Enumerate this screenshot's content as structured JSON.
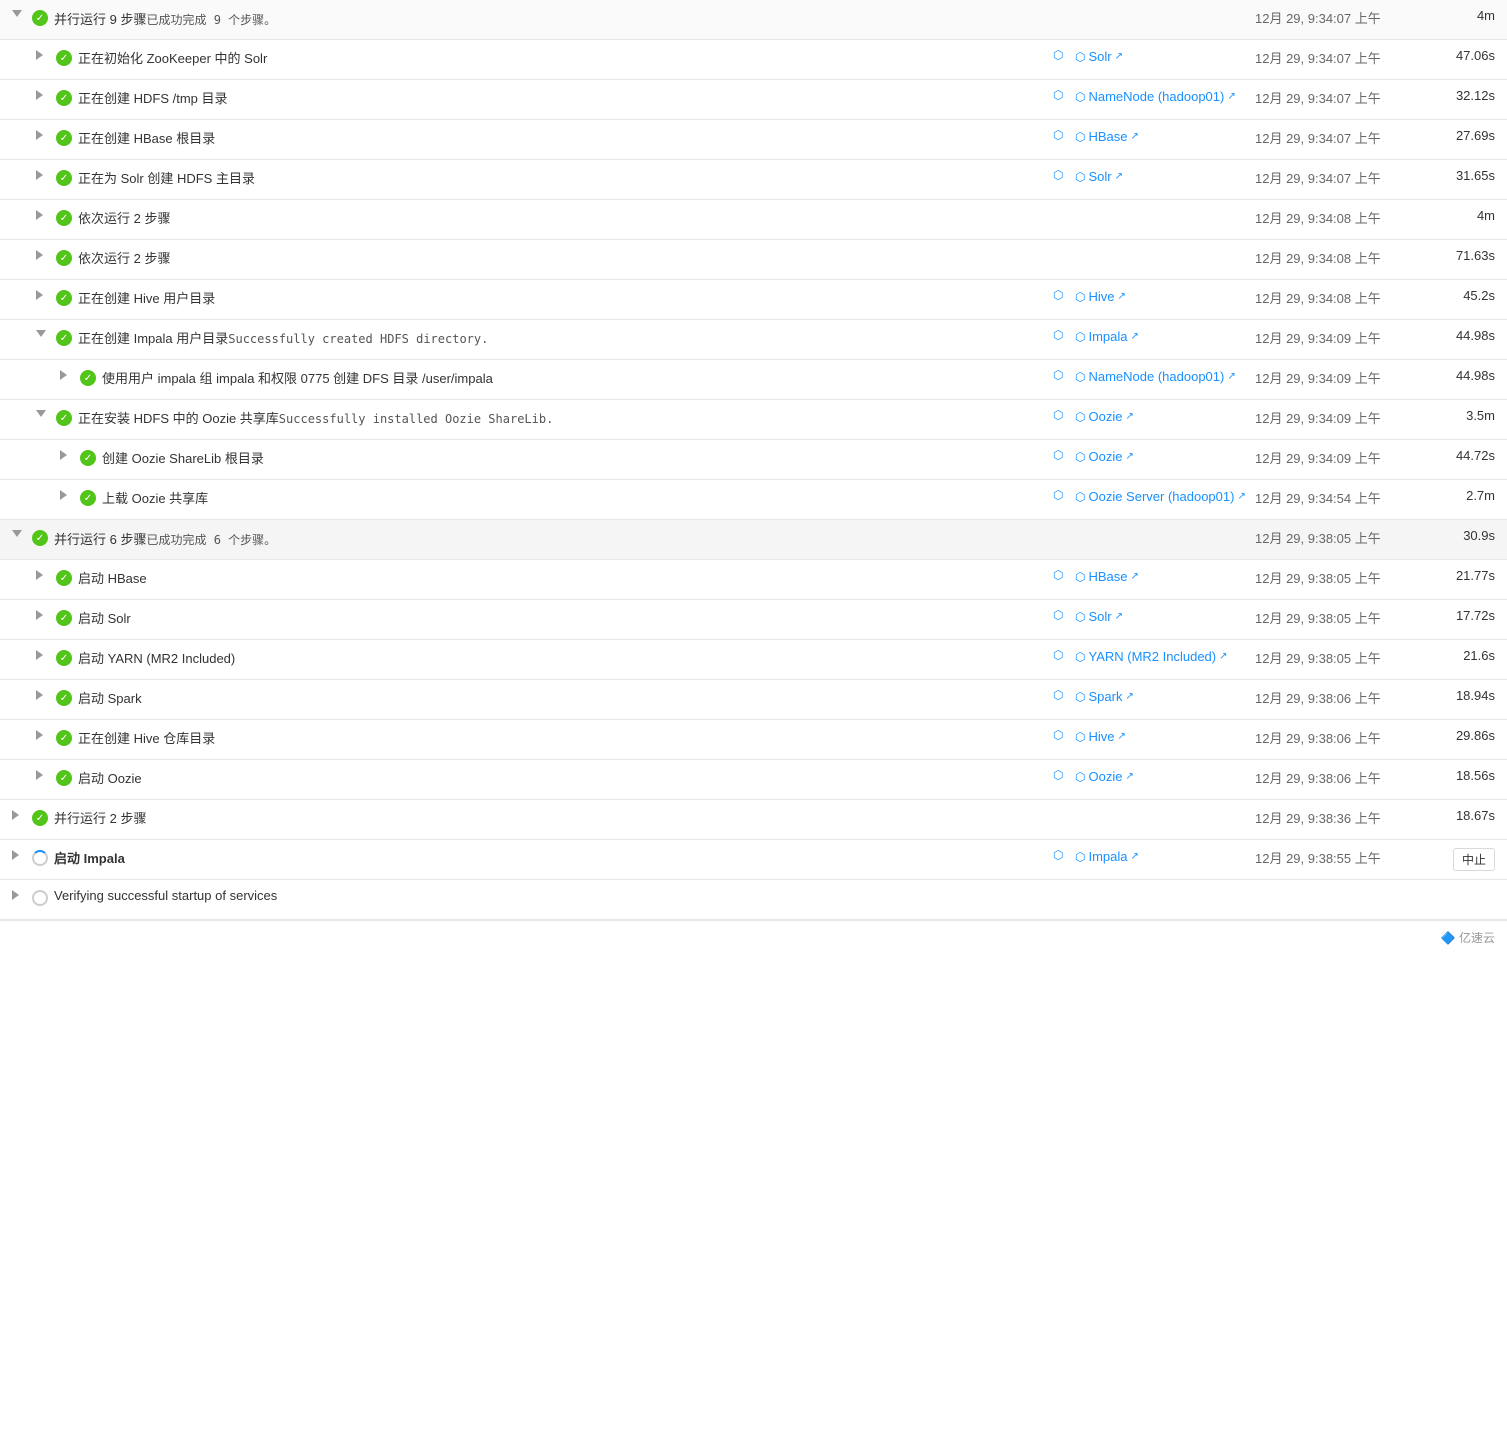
{
  "rows": [
    {
      "id": "parallel-9",
      "type": "parallel-header",
      "indent": 0,
      "expand": "down",
      "status": "success",
      "desc": "并行运行 9 步骤",
      "subdesc": "已成功完成  9  个步骤。",
      "service": "",
      "time": "12月 29, 9:34:07 上午",
      "duration": "4m",
      "action": ""
    },
    {
      "id": "step-solr-init",
      "type": "step",
      "indent": 1,
      "expand": "right",
      "status": "success",
      "desc": "正在初始化 ZooKeeper 中的 Solr",
      "subdesc": "",
      "service": "Solr",
      "time": "12月 29, 9:34:07 上午",
      "duration": "47.06s",
      "action": ""
    },
    {
      "id": "step-hdfs-tmp",
      "type": "step",
      "indent": 1,
      "expand": "right",
      "status": "success",
      "desc": "正在创建 HDFS /tmp 目录",
      "subdesc": "",
      "service": "NameNode (hadoop01)",
      "time": "12月 29, 9:34:07 上午",
      "duration": "32.12s",
      "action": ""
    },
    {
      "id": "step-hbase-root",
      "type": "step",
      "indent": 1,
      "expand": "right",
      "status": "success",
      "desc": "正在创建 HBase 根目录",
      "subdesc": "",
      "service": "HBase",
      "time": "12月 29, 9:34:07 上午",
      "duration": "27.69s",
      "action": ""
    },
    {
      "id": "step-solr-hdfs",
      "type": "step",
      "indent": 1,
      "expand": "right",
      "status": "success",
      "desc": "正在为 Solr 创建 HDFS 主目录",
      "subdesc": "",
      "service": "Solr",
      "time": "12月 29, 9:34:07 上午",
      "duration": "31.65s",
      "action": ""
    },
    {
      "id": "seq-2a",
      "type": "step",
      "indent": 1,
      "expand": "right",
      "status": "success",
      "desc": "依次运行 2 步骤",
      "subdesc": "",
      "service": "",
      "time": "12月 29, 9:34:08 上午",
      "duration": "4m",
      "action": ""
    },
    {
      "id": "seq-2b",
      "type": "step",
      "indent": 1,
      "expand": "right",
      "status": "success",
      "desc": "依次运行 2 步骤",
      "subdesc": "",
      "service": "",
      "time": "12月 29, 9:34:08 上午",
      "duration": "71.63s",
      "action": ""
    },
    {
      "id": "step-hive-user",
      "type": "step",
      "indent": 1,
      "expand": "right",
      "status": "success",
      "desc": "正在创建 Hive 用户目录",
      "subdesc": "",
      "service": "Hive",
      "time": "12月 29, 9:34:08 上午",
      "duration": "45.2s",
      "action": ""
    },
    {
      "id": "step-impala-user",
      "type": "step",
      "indent": 1,
      "expand": "down",
      "status": "success",
      "desc": "正在创建 Impala 用户目录",
      "subdesc": "Successfully created HDFS directory.",
      "service": "Impala",
      "time": "12月 29, 9:34:09 上午",
      "duration": "44.98s",
      "action": ""
    },
    {
      "id": "step-impala-dfs",
      "type": "step",
      "indent": 2,
      "expand": "right",
      "status": "success",
      "desc": "使用用户 impala 组 impala 和权限 0775 创建 DFS 目录 /user/impala",
      "subdesc": "",
      "service": "NameNode (hadoop01)",
      "time": "12月 29, 9:34:09 上午",
      "duration": "44.98s",
      "action": ""
    },
    {
      "id": "step-oozie-sharelib",
      "type": "step",
      "indent": 1,
      "expand": "down",
      "status": "success",
      "desc": "正在安装 HDFS 中的 Oozie 共享库",
      "subdesc": "Successfully installed Oozie ShareLib.",
      "service": "Oozie",
      "time": "12月 29, 9:34:09 上午",
      "duration": "3.5m",
      "action": ""
    },
    {
      "id": "step-oozie-sharelib-root",
      "type": "step",
      "indent": 2,
      "expand": "right",
      "status": "success",
      "desc": "创建 Oozie ShareLib 根目录",
      "subdesc": "",
      "service": "Oozie",
      "time": "12月 29, 9:34:09 上午",
      "duration": "44.72s",
      "action": ""
    },
    {
      "id": "step-oozie-upload",
      "type": "step",
      "indent": 2,
      "expand": "right",
      "status": "success",
      "desc": "上载 Oozie 共享库",
      "subdesc": "",
      "service": "Oozie Server (hadoop01)",
      "time": "12月 29, 9:34:54 上午",
      "duration": "2.7m",
      "action": ""
    },
    {
      "id": "parallel-6",
      "type": "parallel-header",
      "indent": 0,
      "expand": "down-partial",
      "status": "success",
      "desc": "并行运行 6 步骤",
      "subdesc": "已成功完成  6  个步骤。",
      "service": "",
      "time": "12月 29, 9:38:05 上午",
      "duration": "30.9s",
      "action": ""
    },
    {
      "id": "step-start-hbase",
      "type": "step",
      "indent": 1,
      "expand": "right",
      "status": "success",
      "desc": "启动 HBase",
      "subdesc": "",
      "service": "HBase",
      "time": "12月 29, 9:38:05 上午",
      "duration": "21.77s",
      "action": ""
    },
    {
      "id": "step-start-solr",
      "type": "step",
      "indent": 1,
      "expand": "right",
      "status": "success",
      "desc": "启动 Solr",
      "subdesc": "",
      "service": "Solr",
      "time": "12月 29, 9:38:05 上午",
      "duration": "17.72s",
      "action": ""
    },
    {
      "id": "step-start-yarn",
      "type": "step",
      "indent": 1,
      "expand": "right",
      "status": "success",
      "desc": "启动 YARN (MR2 Included)",
      "subdesc": "",
      "service": "YARN (MR2 Included)",
      "time": "12月 29, 9:38:05 上午",
      "duration": "21.6s",
      "action": ""
    },
    {
      "id": "step-start-spark",
      "type": "step",
      "indent": 1,
      "expand": "right",
      "status": "success",
      "desc": "启动 Spark",
      "subdesc": "",
      "service": "Spark",
      "time": "12月 29, 9:38:06 上午",
      "duration": "18.94s",
      "action": ""
    },
    {
      "id": "step-hive-warehouse",
      "type": "step",
      "indent": 1,
      "expand": "right",
      "status": "success",
      "desc": "正在创建 Hive 仓库目录",
      "subdesc": "",
      "service": "Hive",
      "time": "12月 29, 9:38:06 上午",
      "duration": "29.86s",
      "action": ""
    },
    {
      "id": "step-start-oozie",
      "type": "step",
      "indent": 1,
      "expand": "right",
      "status": "success",
      "desc": "启动 Oozie",
      "subdesc": "",
      "service": "Oozie",
      "time": "12月 29, 9:38:06 上午",
      "duration": "18.56s",
      "action": ""
    },
    {
      "id": "parallel-2",
      "type": "step",
      "indent": 0,
      "expand": "right",
      "status": "success",
      "desc": "并行运行 2 步骤",
      "subdesc": "",
      "service": "",
      "time": "12月 29, 9:38:36 上午",
      "duration": "18.67s",
      "action": ""
    },
    {
      "id": "step-start-impala",
      "type": "step",
      "indent": 0,
      "expand": "right",
      "status": "running",
      "desc": "启动 Impala",
      "subdesc": "",
      "service": "Impala",
      "time": "12月 29, 9:38:55 上午",
      "duration": "",
      "action": "中止",
      "bold": true
    },
    {
      "id": "step-verify",
      "type": "step",
      "indent": 0,
      "expand": "right",
      "status": "pending",
      "desc": "Verifying successful startup of services",
      "subdesc": "",
      "service": "",
      "time": "",
      "duration": "",
      "action": ""
    }
  ],
  "logo": "© 亿速云"
}
